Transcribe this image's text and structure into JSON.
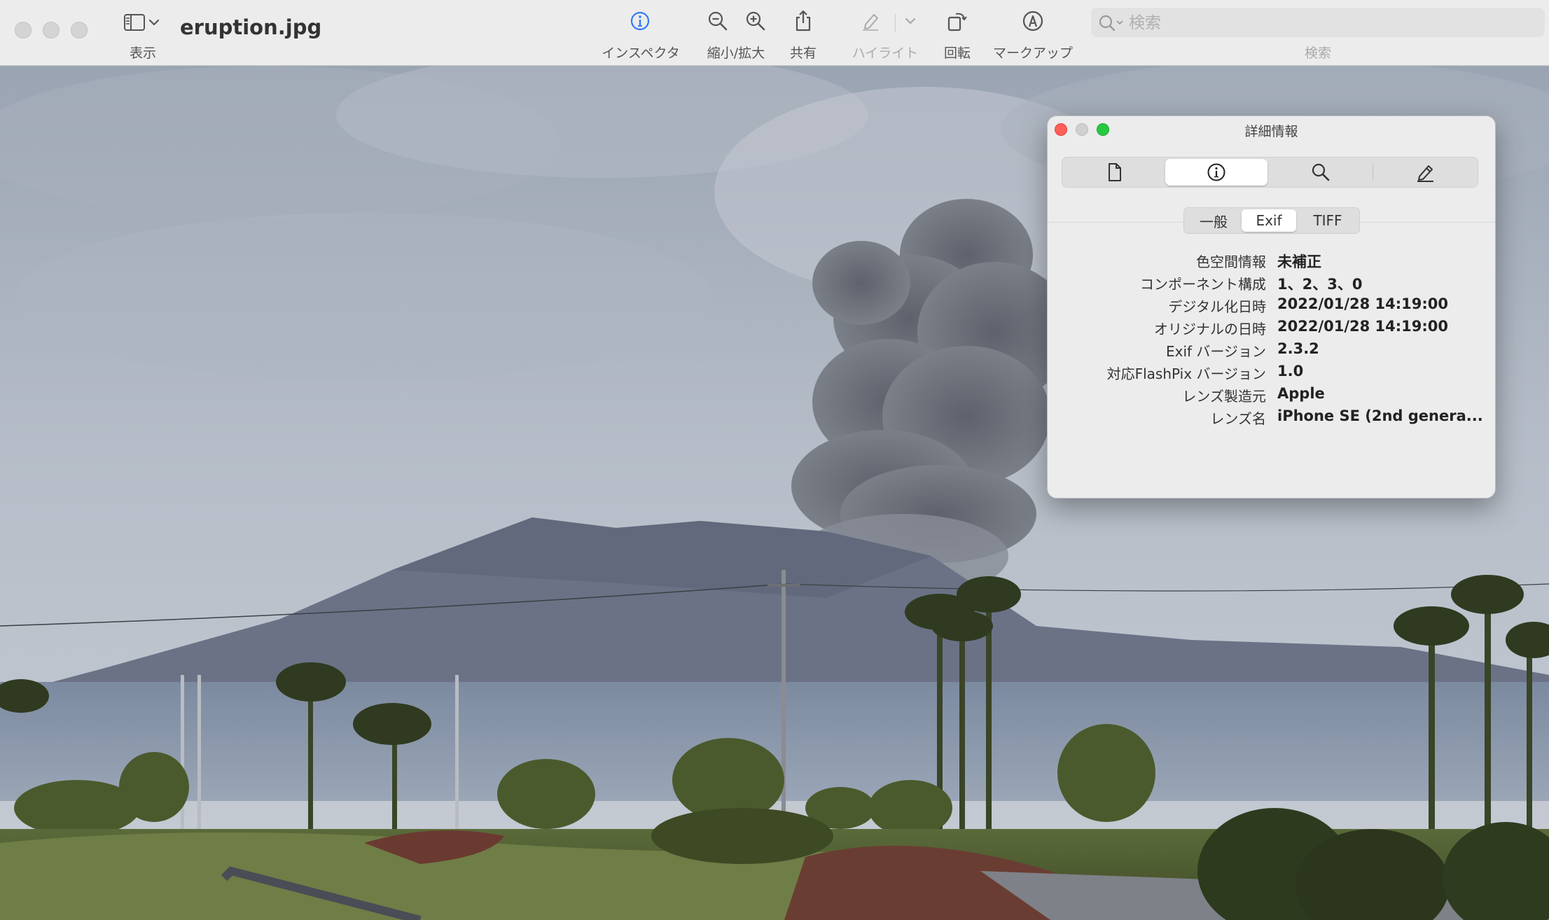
{
  "window": {
    "title": "eruption.jpg",
    "sidebar_label": "表示"
  },
  "toolbar": {
    "inspector_label": "インスペクタ",
    "zoom_label": "縮小/拡大",
    "share_label": "共有",
    "highlight_label": "ハイライト",
    "rotate_label": "回転",
    "markup_label": "マークアップ",
    "search_placeholder": "検索",
    "search_label": "検索"
  },
  "inspector": {
    "title": "詳細情報",
    "tabs": [
      "file-icon",
      "info-icon",
      "magnifier-icon",
      "pencil-icon"
    ],
    "active_tab": "info-icon",
    "subtabs": [
      {
        "label": "一般"
      },
      {
        "label": "Exif"
      },
      {
        "label": "TIFF"
      }
    ],
    "active_subtab": "Exif",
    "rows": [
      {
        "key": "色空間情報",
        "value": "未補正"
      },
      {
        "key": "コンポーネント構成",
        "value": "1、2、3、0"
      },
      {
        "key": "デジタル化日時",
        "value": "2022/01/28 14:19:00"
      },
      {
        "key": "オリジナルの日時",
        "value": "2022/01/28 14:19:00"
      },
      {
        "key": "Exif バージョン",
        "value": "2.3.2"
      },
      {
        "key": "対応FlashPix バージョン",
        "value": "1.0"
      },
      {
        "key": "レンズ製造元",
        "value": "Apple"
      },
      {
        "key": "レンズ名",
        "value": "iPhone SE (2nd genera..."
      }
    ]
  },
  "colors": {
    "close": "#ff5f57",
    "minimize_inactive": "#d0d0d0",
    "zoom": "#28c840",
    "accent": "#2f7cf6"
  }
}
